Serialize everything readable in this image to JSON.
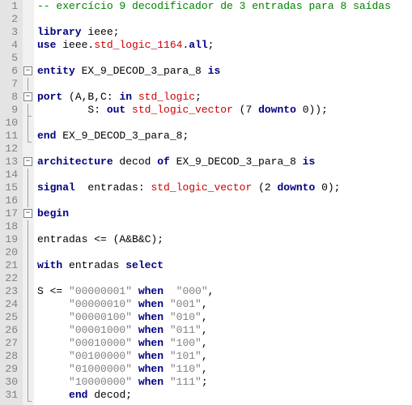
{
  "lines": [
    {
      "n": 1,
      "fold": null,
      "seg": [
        {
          "t": "-- exercício 9 decodificador de 3 entradas para 8 saídas",
          "c": "c-comment"
        }
      ]
    },
    {
      "n": 2,
      "fold": null,
      "seg": []
    },
    {
      "n": 3,
      "fold": null,
      "seg": [
        {
          "t": "library ",
          "c": "c-keyword"
        },
        {
          "t": "ieee;",
          "c": "c-default"
        }
      ]
    },
    {
      "n": 4,
      "fold": null,
      "seg": [
        {
          "t": "use ",
          "c": "c-keyword"
        },
        {
          "t": "ieee.",
          "c": "c-default"
        },
        {
          "t": "std_logic_1164",
          "c": "c-type"
        },
        {
          "t": ".",
          "c": "c-default"
        },
        {
          "t": "all",
          "c": "c-keyword"
        },
        {
          "t": ";",
          "c": "c-default"
        }
      ]
    },
    {
      "n": 5,
      "fold": null,
      "seg": []
    },
    {
      "n": 6,
      "fold": "box",
      "seg": [
        {
          "t": "entity ",
          "c": "c-keyword"
        },
        {
          "t": "EX_9_DECOD_3_para_8 ",
          "c": "c-default"
        },
        {
          "t": "is",
          "c": "c-keyword"
        }
      ]
    },
    {
      "n": 7,
      "fold": "line",
      "seg": []
    },
    {
      "n": 8,
      "fold": "box-nested",
      "seg": [
        {
          "t": "port ",
          "c": "c-keyword"
        },
        {
          "t": "(A,B,C: ",
          "c": "c-default"
        },
        {
          "t": "in ",
          "c": "c-keyword"
        },
        {
          "t": "std_logic",
          "c": "c-type"
        },
        {
          "t": ";",
          "c": "c-default"
        }
      ]
    },
    {
      "n": 9,
      "fold": "end-nested",
      "seg": [
        {
          "t": "        S: ",
          "c": "c-default"
        },
        {
          "t": "out ",
          "c": "c-keyword"
        },
        {
          "t": "std_logic_vector ",
          "c": "c-type"
        },
        {
          "t": "(7 ",
          "c": "c-default"
        },
        {
          "t": "downto ",
          "c": "c-keyword"
        },
        {
          "t": "0));",
          "c": "c-default"
        }
      ]
    },
    {
      "n": 10,
      "fold": "line",
      "seg": []
    },
    {
      "n": 11,
      "fold": "end",
      "seg": [
        {
          "t": "end ",
          "c": "c-keyword"
        },
        {
          "t": "EX_9_DECOD_3_para_8;",
          "c": "c-default"
        }
      ]
    },
    {
      "n": 12,
      "fold": null,
      "seg": []
    },
    {
      "n": 13,
      "fold": "box",
      "seg": [
        {
          "t": "architecture ",
          "c": "c-keyword"
        },
        {
          "t": "decod ",
          "c": "c-default"
        },
        {
          "t": "of ",
          "c": "c-keyword"
        },
        {
          "t": "EX_9_DECOD_3_para_8 ",
          "c": "c-default"
        },
        {
          "t": "is",
          "c": "c-keyword"
        }
      ]
    },
    {
      "n": 14,
      "fold": "line",
      "seg": []
    },
    {
      "n": 15,
      "fold": "line",
      "seg": [
        {
          "t": "signal  ",
          "c": "c-keyword"
        },
        {
          "t": "entradas: ",
          "c": "c-default"
        },
        {
          "t": "std_logic_vector ",
          "c": "c-type"
        },
        {
          "t": "(2 ",
          "c": "c-default"
        },
        {
          "t": "downto ",
          "c": "c-keyword"
        },
        {
          "t": "0);",
          "c": "c-default"
        }
      ]
    },
    {
      "n": 16,
      "fold": "line",
      "seg": []
    },
    {
      "n": 17,
      "fold": "box-nested",
      "seg": [
        {
          "t": "begin",
          "c": "c-keyword"
        }
      ]
    },
    {
      "n": 18,
      "fold": "line",
      "seg": []
    },
    {
      "n": 19,
      "fold": "line",
      "seg": [
        {
          "t": "entradas <= (A&B&C);",
          "c": "c-default"
        }
      ]
    },
    {
      "n": 20,
      "fold": "line",
      "seg": []
    },
    {
      "n": 21,
      "fold": "line",
      "seg": [
        {
          "t": "with ",
          "c": "c-keyword"
        },
        {
          "t": "entradas ",
          "c": "c-default"
        },
        {
          "t": "select",
          "c": "c-keyword"
        }
      ]
    },
    {
      "n": 22,
      "fold": "line",
      "seg": []
    },
    {
      "n": 23,
      "fold": "line",
      "seg": [
        {
          "t": "S <= ",
          "c": "c-default"
        },
        {
          "t": "\"00000001\"",
          "c": "c-string"
        },
        {
          "t": " when  ",
          "c": "c-keyword"
        },
        {
          "t": "\"000\"",
          "c": "c-string"
        },
        {
          "t": ",",
          "c": "c-default"
        }
      ]
    },
    {
      "n": 24,
      "fold": "line",
      "seg": [
        {
          "t": "     ",
          "c": "c-default"
        },
        {
          "t": "\"00000010\"",
          "c": "c-string"
        },
        {
          "t": " when ",
          "c": "c-keyword"
        },
        {
          "t": "\"001\"",
          "c": "c-string"
        },
        {
          "t": ",",
          "c": "c-default"
        }
      ]
    },
    {
      "n": 25,
      "fold": "line",
      "seg": [
        {
          "t": "     ",
          "c": "c-default"
        },
        {
          "t": "\"00000100\"",
          "c": "c-string"
        },
        {
          "t": " when ",
          "c": "c-keyword"
        },
        {
          "t": "\"010\"",
          "c": "c-string"
        },
        {
          "t": ",",
          "c": "c-default"
        }
      ]
    },
    {
      "n": 26,
      "fold": "line",
      "seg": [
        {
          "t": "     ",
          "c": "c-default"
        },
        {
          "t": "\"00001000\"",
          "c": "c-string"
        },
        {
          "t": " when ",
          "c": "c-keyword"
        },
        {
          "t": "\"011\"",
          "c": "c-string"
        },
        {
          "t": ",",
          "c": "c-default"
        }
      ]
    },
    {
      "n": 27,
      "fold": "line",
      "seg": [
        {
          "t": "     ",
          "c": "c-default"
        },
        {
          "t": "\"00010000\"",
          "c": "c-string"
        },
        {
          "t": " when ",
          "c": "c-keyword"
        },
        {
          "t": "\"100\"",
          "c": "c-string"
        },
        {
          "t": ",",
          "c": "c-default"
        }
      ]
    },
    {
      "n": 28,
      "fold": "line",
      "seg": [
        {
          "t": "     ",
          "c": "c-default"
        },
        {
          "t": "\"00100000\"",
          "c": "c-string"
        },
        {
          "t": " when ",
          "c": "c-keyword"
        },
        {
          "t": "\"101\"",
          "c": "c-string"
        },
        {
          "t": ",",
          "c": "c-default"
        }
      ]
    },
    {
      "n": 29,
      "fold": "line",
      "seg": [
        {
          "t": "     ",
          "c": "c-default"
        },
        {
          "t": "\"01000000\"",
          "c": "c-string"
        },
        {
          "t": " when ",
          "c": "c-keyword"
        },
        {
          "t": "\"110\"",
          "c": "c-string"
        },
        {
          "t": ",",
          "c": "c-default"
        }
      ]
    },
    {
      "n": 30,
      "fold": "line",
      "seg": [
        {
          "t": "     ",
          "c": "c-default"
        },
        {
          "t": "\"10000000\"",
          "c": "c-string"
        },
        {
          "t": " when ",
          "c": "c-keyword"
        },
        {
          "t": "\"111\"",
          "c": "c-string"
        },
        {
          "t": ";",
          "c": "c-default"
        }
      ]
    },
    {
      "n": 31,
      "fold": "end",
      "seg": [
        {
          "t": "     ",
          "c": "c-default"
        },
        {
          "t": "end ",
          "c": "c-keyword"
        },
        {
          "t": "decod;",
          "c": "c-default"
        }
      ]
    }
  ]
}
